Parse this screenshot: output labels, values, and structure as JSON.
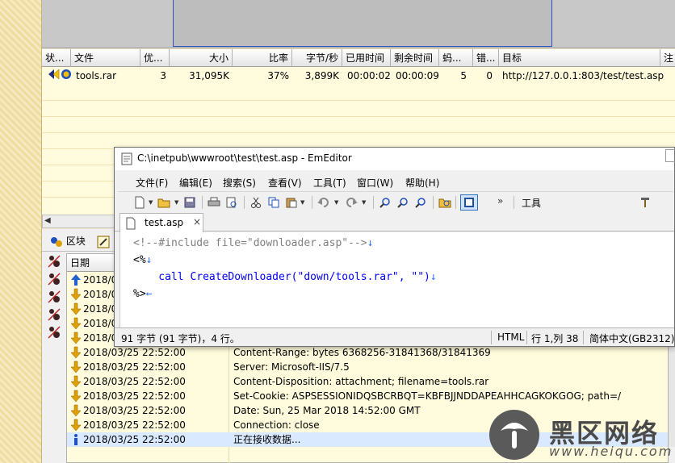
{
  "task_list": {
    "columns": [
      "状...",
      "文件",
      "优...",
      "大小",
      "比率",
      "字节/秒",
      "已用时间",
      "剩余时间",
      "蚂...",
      "错...",
      "目标",
      "注"
    ],
    "rows": [
      {
        "file": "tools.rar",
        "priority": "3",
        "size": "31,095K",
        "ratio": "37%",
        "speed": "3,899K",
        "elapsed": "00:00:02",
        "remaining": "00:00:09",
        "ants": "5",
        "errors": "0",
        "target": "http://127.0.0.1:803/test/test.asp"
      }
    ]
  },
  "log_pane": {
    "tab_blocks": "区块",
    "header_date": "日期",
    "rows": [
      {
        "icon": "arrow-up-icon",
        "datetime": "2018/0",
        "message": ""
      },
      {
        "icon": "arrow-down-icon",
        "datetime": "2018/0",
        "message": ""
      },
      {
        "icon": "arrow-down-icon",
        "datetime": "2018/0",
        "message": ""
      },
      {
        "icon": "arrow-down-icon",
        "datetime": "2018/0",
        "message": ""
      },
      {
        "icon": "arrow-down-icon",
        "datetime": "2018/0",
        "message": ""
      },
      {
        "icon": "arrow-down-icon",
        "datetime": "2018/03/25 22:52:00",
        "message": "Content-Range: bytes 6368256-31841368/31841369"
      },
      {
        "icon": "arrow-down-icon",
        "datetime": "2018/03/25 22:52:00",
        "message": "Server: Microsoft-IIS/7.5"
      },
      {
        "icon": "arrow-down-icon",
        "datetime": "2018/03/25 22:52:00",
        "message": "Content-Disposition: attachment; filename=tools.rar"
      },
      {
        "icon": "arrow-down-icon",
        "datetime": "2018/03/25 22:52:00",
        "message": "Set-Cookie: ASPSESSIONIDQSBCRBQT=KBFBJJNDDAPEAHHCAGKOKGOG; path=/"
      },
      {
        "icon": "arrow-down-icon",
        "datetime": "2018/03/25 22:52:00",
        "message": "Date: Sun, 25 Mar 2018 14:52:00 GMT"
      },
      {
        "icon": "arrow-down-icon",
        "datetime": "2018/03/25 22:52:00",
        "message": "Connection: close"
      },
      {
        "icon": "info-icon",
        "datetime": "2018/03/25 22:52:00",
        "message": "正在接收数据..."
      }
    ]
  },
  "emeditor": {
    "title": "C:\\inetpub\\wwwroot\\test\\test.asp - EmEditor",
    "menu": [
      "文件(F)",
      "编辑(E)",
      "搜索(S)",
      "查看(V)",
      "工具(T)",
      "窗口(W)",
      "帮助(H)"
    ],
    "toolbar_tools_label": "工具",
    "toolbar_more": "»",
    "tab_label": "test.asp",
    "tab_close": "×",
    "code_lines": [
      "<!--#include file=\"downloader.asp\"-->",
      "<%",
      "    call CreateDownloader(\"down/tools.rar\", \"\")",
      "%>"
    ],
    "status": {
      "chars": "91 字节 (91 字节)，4 行。",
      "mode": "HTML",
      "position": "行 1,列 38",
      "encoding": "简体中文(GB2312)"
    }
  },
  "watermark": {
    "cn": "黑区网络",
    "url": "www.heiqu.com"
  },
  "colors": {
    "task_bg": "#fffbdc",
    "accent_blue": "#3050c0",
    "code_keyword": "#0000ff"
  }
}
